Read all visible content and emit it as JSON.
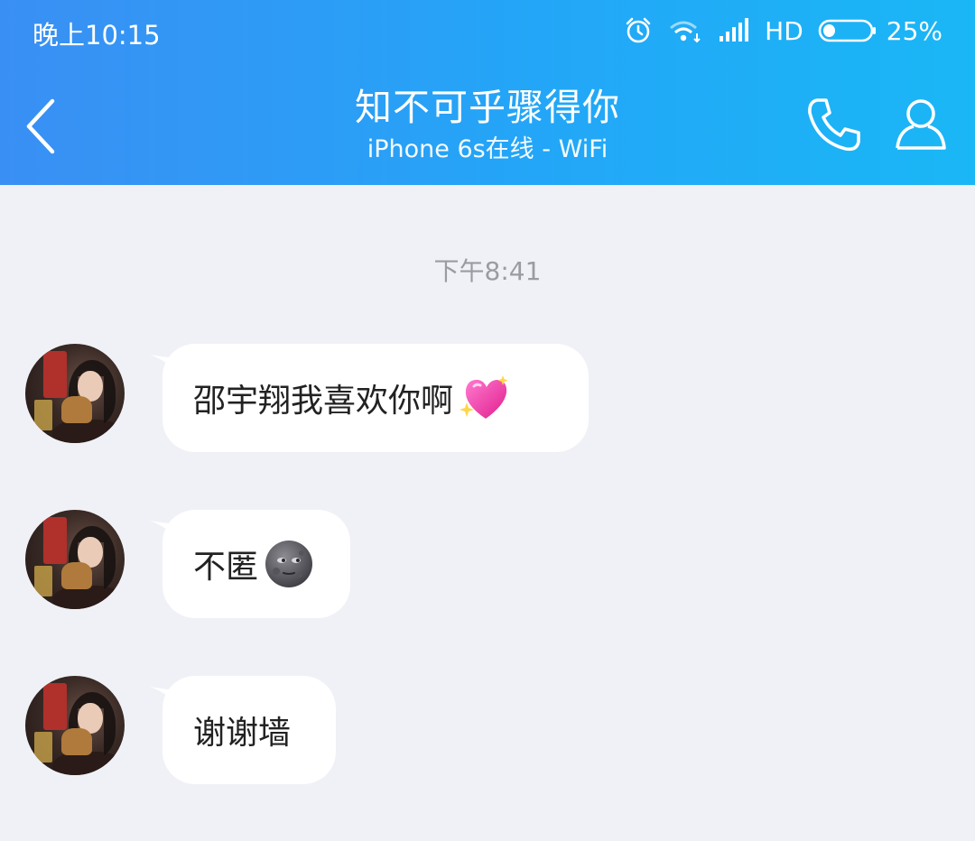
{
  "status_bar": {
    "time": "晚上10:15",
    "network": "HD",
    "battery_percent": "25%",
    "battery_level": 0.25,
    "icons": [
      "alarm-icon",
      "wifi-icon",
      "signal-icon",
      "battery-icon"
    ]
  },
  "header": {
    "title": "知不可乎骤得你",
    "subtitle": "iPhone 6s在线 - WiFi",
    "icons": [
      "back-chevron-icon",
      "phone-icon",
      "person-icon"
    ]
  },
  "chat": {
    "timestamp": "下午8:41",
    "messages": [
      {
        "text": "邵宇翔我喜欢你啊",
        "emoji": "sparkling-heart-emoji"
      },
      {
        "text": "不匿",
        "emoji": "new-moon-face-emoji"
      },
      {
        "text": "谢谢墙",
        "emoji": ""
      }
    ]
  },
  "colors": {
    "header_gradient_start": "#3a8ff4",
    "header_gradient_end": "#1ab7f6",
    "chat_background": "#f0f1f6",
    "bubble_background": "#ffffff",
    "timestamp_text": "#9a9ca3"
  }
}
